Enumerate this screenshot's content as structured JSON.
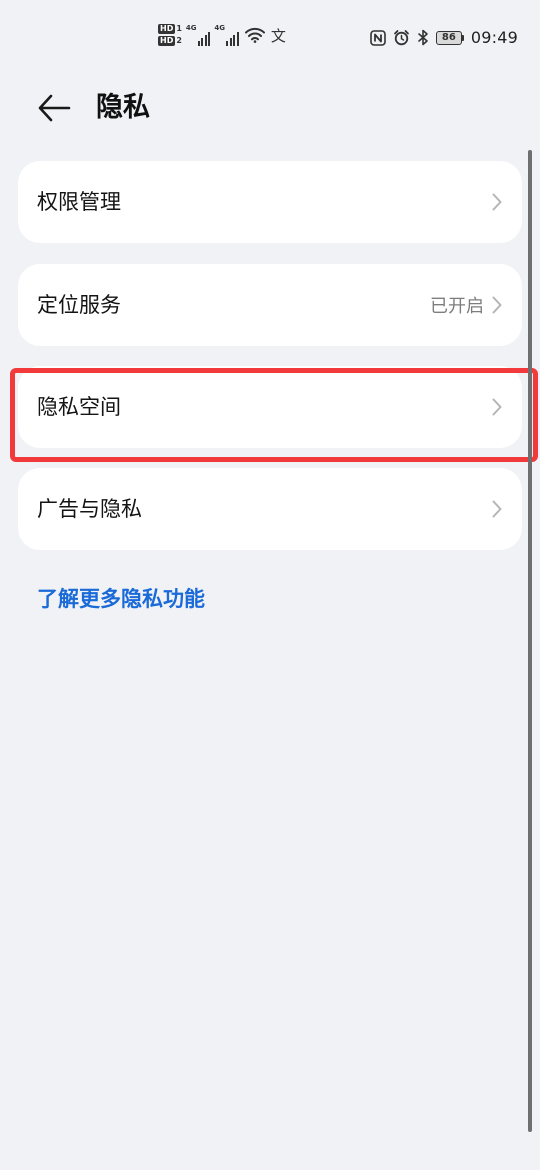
{
  "status_bar": {
    "hd1": "HD",
    "hd1_num": "1",
    "hd2": "HD",
    "hd2_num": "2",
    "signal1_type": "4G",
    "signal2_type": "4G",
    "wifi_icon": "wifi-icon",
    "extra_icon": "文",
    "nfc_icon": "nfc-icon",
    "alarm_icon": "alarm-icon",
    "bluetooth_icon": "bluetooth-icon",
    "battery_level": "86",
    "time": "09:49"
  },
  "header": {
    "back_icon": "arrow-left-icon",
    "title": "隐私"
  },
  "settings": {
    "items": [
      {
        "label": "权限管理",
        "value": ""
      },
      {
        "label": "定位服务",
        "value": "已开启"
      },
      {
        "label": "隐私空间",
        "value": ""
      },
      {
        "label": "广告与隐私",
        "value": ""
      }
    ]
  },
  "link": {
    "more_privacy": "了解更多隐私功能"
  },
  "colors": {
    "background": "#f1f2f5",
    "card": "#ffffff",
    "link": "#1a6ad8",
    "highlight": "#f23a3c"
  }
}
